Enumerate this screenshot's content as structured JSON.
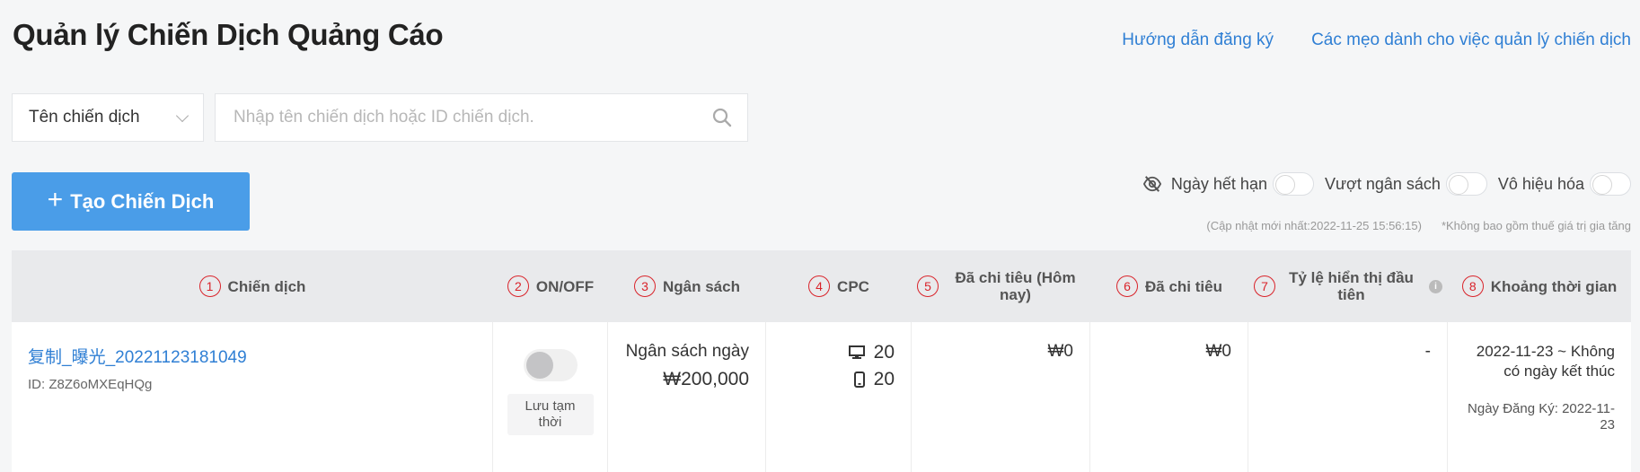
{
  "header": {
    "title": "Quản lý Chiến Dịch Quảng Cáo",
    "links": [
      "Hướng dẫn đăng ký",
      "Các mẹo dành cho việc quản lý chiến dịch"
    ]
  },
  "search": {
    "type_select": "Tên chiến dịch",
    "placeholder": "Nhập tên chiến dịch hoặc ID chiến dịch.",
    "value": ""
  },
  "create_button": "Tạo Chiến Dịch",
  "filters": {
    "expired": "Ngày hết hạn",
    "over_budget": "Vượt ngân sách",
    "disabled": "Vô hiệu hóa"
  },
  "updated_note": "(Cập nhật mới nhất:2022-11-25 15:56:15)",
  "vat_note": "*Không bao gồm thuế giá trị gia tăng",
  "table": {
    "columns": [
      {
        "num": "1",
        "label": "Chiến dịch"
      },
      {
        "num": "2",
        "label": "ON/OFF"
      },
      {
        "num": "3",
        "label": "Ngân sách"
      },
      {
        "num": "4",
        "label": "CPC"
      },
      {
        "num": "5",
        "label": "Đã chi tiêu (Hôm nay)"
      },
      {
        "num": "6",
        "label": "Đã chi tiêu"
      },
      {
        "num": "7",
        "label": "Tỷ lệ hiển thị đầu tiên",
        "info": "i"
      },
      {
        "num": "8",
        "label": "Khoảng thời gian"
      }
    ],
    "rows": [
      {
        "name": "复制_曝光_20221123181049",
        "id": "ID: Z8Z6oMXEqHQg",
        "status_label": "Lưu tạm thời",
        "budget_label": "Ngân sách ngày",
        "budget_value": "₩200,000",
        "cpc_desktop": "20",
        "cpc_mobile": "20",
        "spent_today": "₩0",
        "spent": "₩0",
        "first_impression": "-",
        "period": "2022-11-23 ~ Không có ngày kết thúc",
        "registered": "Ngày Đăng Ký: 2022-11-23"
      }
    ]
  },
  "colors": {
    "accent": "#4a9de8",
    "link": "#2f7fd4",
    "number_circle": "#d9232a"
  }
}
